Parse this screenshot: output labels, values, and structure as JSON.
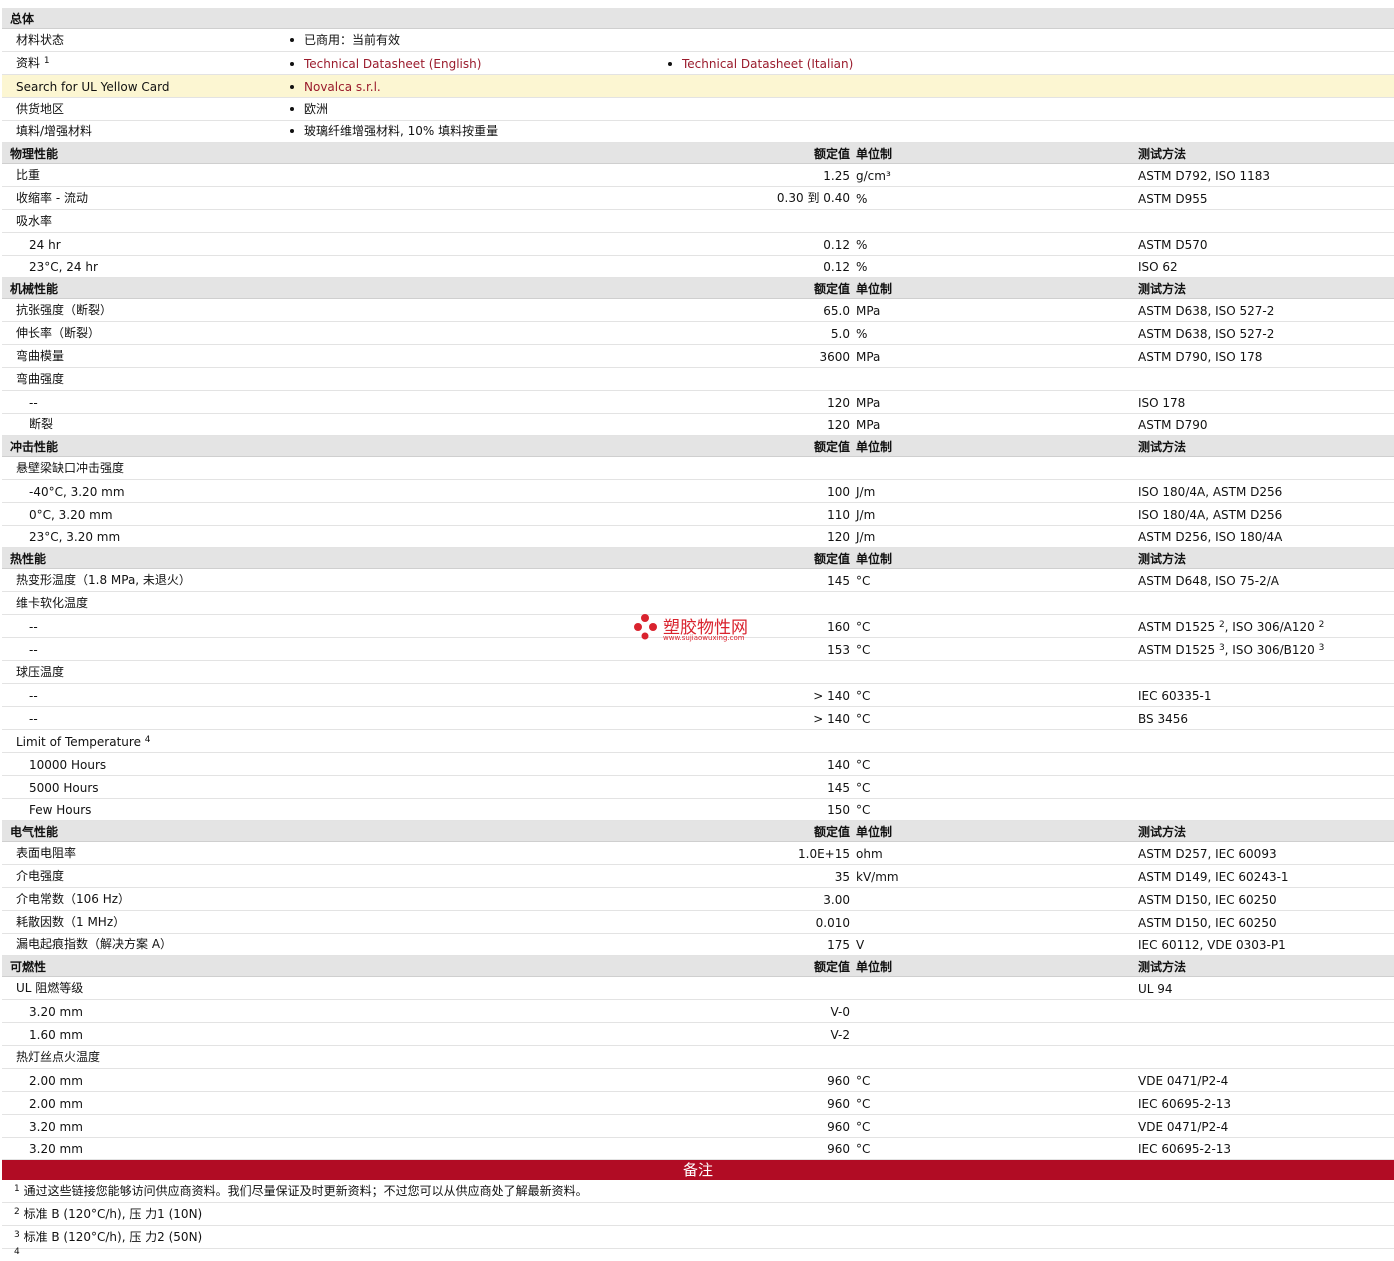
{
  "sections": {
    "general": "总体",
    "physical": "物理性能",
    "mechanical": "机械性能",
    "impact": "冲击性能",
    "thermal": "热性能",
    "electrical": "电气性能",
    "flammability": "可燃性"
  },
  "col_headers": {
    "value": "额定值",
    "unit": "单位制",
    "test": "测试方法"
  },
  "general": {
    "status_label": "材料状态",
    "status_value": "已商用：当前有效",
    "docs_label": "资料",
    "docs_sup": "1",
    "doc_en": "Technical Datasheet (English)",
    "doc_it": "Technical Datasheet (Italian)",
    "ul_label": "Search for UL Yellow Card",
    "ul_value": "Novalca s.r.l.",
    "region_label": "供货地区",
    "region_value": "欧洲",
    "filler_label": "填料/增强材料",
    "filler_value": "玻璃纤维增强材料, 10% 填料按重量"
  },
  "physical": {
    "r1": {
      "name": "比重",
      "value": "1.25",
      "unit": "g/cm³",
      "test": "ASTM D792, ISO 1183"
    },
    "r2": {
      "name": "收缩率  - 流动",
      "value": "0.30 到  0.40",
      "unit": "%",
      "test": "ASTM D955"
    },
    "r3": {
      "name": "吸水率"
    },
    "r4": {
      "name": "24 hr",
      "value": "0.12",
      "unit": "%",
      "test": "ASTM D570"
    },
    "r5": {
      "name": "23°C, 24 hr",
      "value": "0.12",
      "unit": "%",
      "test": "ISO 62"
    }
  },
  "mechanical": {
    "r1": {
      "name": "抗张强度（断裂）",
      "value": "65.0",
      "unit": "MPa",
      "test": "ASTM D638, ISO 527-2"
    },
    "r2": {
      "name": "伸长率（断裂）",
      "value": "5.0",
      "unit": "%",
      "test": "ASTM D638, ISO 527-2"
    },
    "r3": {
      "name": "弯曲模量",
      "value": "3600",
      "unit": "MPa",
      "test": "ASTM D790, ISO 178"
    },
    "r4": {
      "name": "弯曲强度"
    },
    "r5": {
      "name": "--",
      "value": "120",
      "unit": "MPa",
      "test": "ISO 178"
    },
    "r6": {
      "name": "断裂",
      "value": "120",
      "unit": "MPa",
      "test": "ASTM D790"
    }
  },
  "impact": {
    "r1": {
      "name": "悬壁梁缺口冲击强度"
    },
    "r2": {
      "name": "-40°C, 3.20 mm",
      "value": "100",
      "unit": "J/m",
      "test": "ISO 180/4A, ASTM D256"
    },
    "r3": {
      "name": "0°C, 3.20 mm",
      "value": "110",
      "unit": "J/m",
      "test": "ISO 180/4A, ASTM D256"
    },
    "r4": {
      "name": "23°C, 3.20 mm",
      "value": "120",
      "unit": "J/m",
      "test": "ASTM D256, ISO 180/4A"
    }
  },
  "thermal": {
    "r1": {
      "name": "热变形温度（1.8 MPa, 未退火）",
      "value": "145",
      "unit": "°C",
      "test": "ASTM D648, ISO 75-2/A"
    },
    "r2": {
      "name": "维卡软化温度"
    },
    "r3": {
      "name": "--",
      "value": "160",
      "unit": "°C",
      "test_a": "ASTM D1525",
      "sup_a": "2",
      "test_b": ", ISO 306/A120",
      "sup_b": "2"
    },
    "r4": {
      "name": "--",
      "value": "153",
      "unit": "°C",
      "test_a": "ASTM D1525",
      "sup_a": "3",
      "test_b": ", ISO 306/B120",
      "sup_b": "3"
    },
    "r5": {
      "name": "球压温度"
    },
    "r6": {
      "name": "--",
      "value": "> 140",
      "unit": "°C",
      "test": "IEC 60335-1"
    },
    "r7": {
      "name": "--",
      "value": "> 140",
      "unit": "°C",
      "test": "BS 3456"
    },
    "r8": {
      "name": "Limit of Temperature",
      "sup": "4"
    },
    "r9": {
      "name": "10000 Hours",
      "value": "140",
      "unit": "°C"
    },
    "r10": {
      "name": "5000 Hours",
      "value": "145",
      "unit": "°C"
    },
    "r11": {
      "name": "Few Hours",
      "value": "150",
      "unit": "°C"
    }
  },
  "electrical": {
    "r1": {
      "name": "表面电阻率",
      "value": "1.0E+15",
      "unit": "ohm",
      "test": "ASTM D257, IEC 60093"
    },
    "r2": {
      "name": "介电强度",
      "value": "35",
      "unit": "kV/mm",
      "test": "ASTM D149, IEC 60243-1"
    },
    "r3": {
      "name": "介电常数（106 Hz）",
      "value": "3.00",
      "test": "ASTM D150, IEC 60250"
    },
    "r4": {
      "name": "耗散因数（1 MHz）",
      "value": "0.010",
      "test": "ASTM D150, IEC 60250"
    },
    "r5": {
      "name": "漏电起痕指数（解决方案 A）",
      "value": "175",
      "unit": "V",
      "test": "IEC 60112, VDE 0303-P1"
    }
  },
  "flammability": {
    "r1": {
      "name": "UL 阻燃等级",
      "test": "UL 94"
    },
    "r2": {
      "name": "3.20 mm",
      "value": "V-0"
    },
    "r3": {
      "name": "1.60 mm",
      "value": "V-2"
    },
    "r4": {
      "name": "热灯丝点火温度"
    },
    "r5": {
      "name": "2.00 mm",
      "value": "960",
      "unit": "°C",
      "test": "VDE 0471/P2-4"
    },
    "r6": {
      "name": "2.00 mm",
      "value": "960",
      "unit": "°C",
      "test": "IEC 60695-2-13"
    },
    "r7": {
      "name": "3.20 mm",
      "value": "960",
      "unit": "°C",
      "test": "VDE 0471/P2-4"
    },
    "r8": {
      "name": "3.20 mm",
      "value": "960",
      "unit": "°C",
      "test": "IEC 60695-2-13"
    }
  },
  "notes": {
    "title": "备注",
    "n1": {
      "sup": "1",
      "text": "通过这些链接您能够访问供应商资料。我们尽量保证及时更新资料；不过您可以从供应商处了解最新资料。"
    },
    "n2": {
      "sup": "2",
      "text": "标准  B (120°C/h), 压  力1 (10N)"
    },
    "n3": {
      "sup": "3",
      "text": "标准  B (120°C/h), 压  力2 (50N)"
    },
    "n4": {
      "sup": "4"
    }
  },
  "watermark": {
    "text": "塑胶物性网",
    "sub": "www.sujiaowuxing.com",
    "color": "#d9232e"
  },
  "colors": {
    "link": "#9a1b2c",
    "notes_bar": "#b10c24",
    "section_bg": "#e4e4e4",
    "highlight_bg": "#fcf6d2"
  }
}
